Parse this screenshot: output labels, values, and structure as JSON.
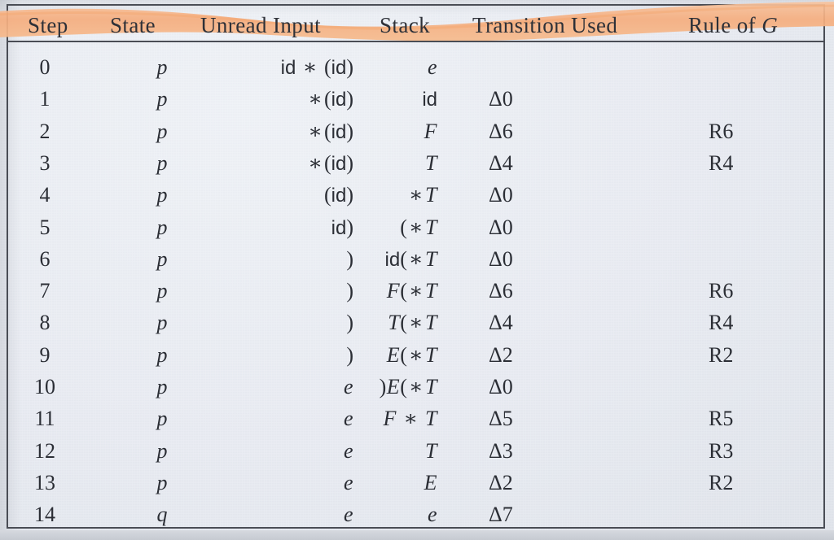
{
  "document": {
    "type": "scanned-textbook-table",
    "caption_visible": false,
    "highlight_color": "#f6b68b",
    "paper_color": "#e8ebf1",
    "ink_color": "#2b2e35",
    "rule_color": "#4a4d55"
  },
  "table": {
    "columns": [
      {
        "key": "step",
        "label": "Step",
        "align": "center"
      },
      {
        "key": "state",
        "label": "State",
        "align": "center"
      },
      {
        "key": "input",
        "label": "Unread Input",
        "align": "right"
      },
      {
        "key": "stack",
        "label": "Stack",
        "align": "right"
      },
      {
        "key": "transition",
        "label": "Transition Used",
        "align": "left"
      },
      {
        "key": "rule",
        "label": "Rule of G",
        "align": "left"
      }
    ],
    "header_italic_part": "G",
    "rows": [
      {
        "step": "0",
        "state": "p",
        "input": "id ∗ (id)",
        "stack": "e",
        "transition": "",
        "rule": ""
      },
      {
        "step": "1",
        "state": "p",
        "input": "∗(id)",
        "stack": "id",
        "transition": "Δ0",
        "rule": ""
      },
      {
        "step": "2",
        "state": "p",
        "input": "∗(id)",
        "stack": "F",
        "transition": "Δ6",
        "rule": "R6"
      },
      {
        "step": "3",
        "state": "p",
        "input": "∗(id)",
        "stack": "T",
        "transition": "Δ4",
        "rule": "R4"
      },
      {
        "step": "4",
        "state": "p",
        "input": "(id)",
        "stack": "∗T",
        "transition": "Δ0",
        "rule": ""
      },
      {
        "step": "5",
        "state": "p",
        "input": "id)",
        "stack": "(∗T",
        "transition": "Δ0",
        "rule": ""
      },
      {
        "step": "6",
        "state": "p",
        "input": ")",
        "stack": "id(∗T",
        "transition": "Δ0",
        "rule": ""
      },
      {
        "step": "7",
        "state": "p",
        "input": ")",
        "stack": "F(∗T",
        "transition": "Δ6",
        "rule": "R6"
      },
      {
        "step": "8",
        "state": "p",
        "input": ")",
        "stack": "T(∗T",
        "transition": "Δ4",
        "rule": "R4"
      },
      {
        "step": "9",
        "state": "p",
        "input": ")",
        "stack": "E(∗T",
        "transition": "Δ2",
        "rule": "R2"
      },
      {
        "step": "10",
        "state": "p",
        "input": "e",
        "stack": ")E(∗T",
        "transition": "Δ0",
        "rule": ""
      },
      {
        "step": "11",
        "state": "p",
        "input": "e",
        "stack": "F ∗ T",
        "transition": "Δ5",
        "rule": "R5"
      },
      {
        "step": "12",
        "state": "p",
        "input": "e",
        "stack": "T",
        "transition": "Δ3",
        "rule": "R3"
      },
      {
        "step": "13",
        "state": "p",
        "input": "e",
        "stack": "E",
        "transition": "Δ2",
        "rule": "R2"
      },
      {
        "step": "14",
        "state": "q",
        "input": "e",
        "stack": "e",
        "transition": "Δ7",
        "rule": ""
      }
    ]
  }
}
